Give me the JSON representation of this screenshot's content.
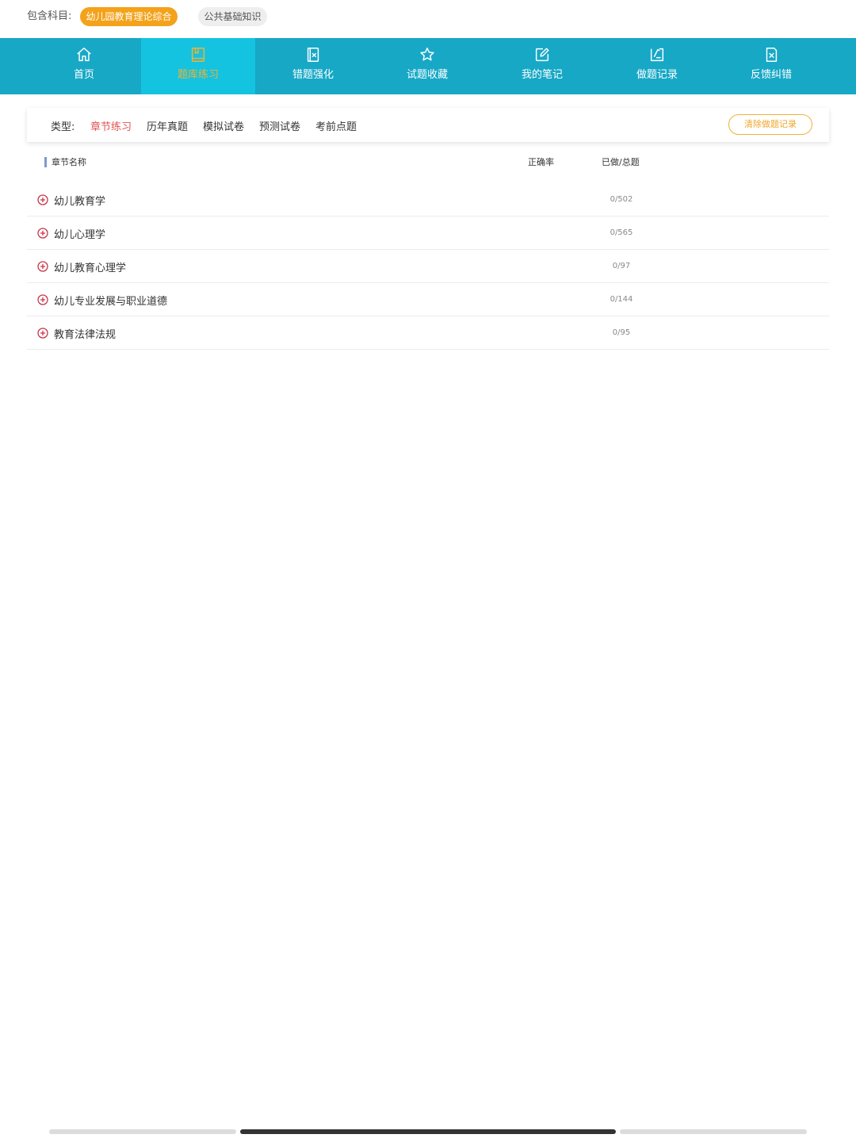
{
  "subject_bar": {
    "label": "包含科目:",
    "subjects": [
      {
        "label": "幼儿园教育理论综合",
        "active": true
      },
      {
        "label": "公共基础知识",
        "active": false
      }
    ]
  },
  "nav": {
    "items": [
      {
        "label": "首页",
        "icon": "home-icon"
      },
      {
        "label": "题库练习",
        "icon": "book-icon",
        "active": true
      },
      {
        "label": "错题强化",
        "icon": "error-doc-icon"
      },
      {
        "label": "试题收藏",
        "icon": "star-icon"
      },
      {
        "label": "我的笔记",
        "icon": "edit-note-icon"
      },
      {
        "label": "做题记录",
        "icon": "record-icon"
      },
      {
        "label": "反馈纠错",
        "icon": "feedback-x-icon"
      }
    ]
  },
  "type_filter": {
    "label": "类型:",
    "options": [
      "章节练习",
      "历年真题",
      "模拟试卷",
      "预测试卷",
      "考前点题"
    ],
    "selected": "章节练习",
    "clear_button": "清除做题记录"
  },
  "table": {
    "headers": {
      "name": "章节名称",
      "accuracy": "正确率",
      "progress": "已做/总题"
    },
    "rows": [
      {
        "name": "幼儿教育学",
        "progress": "0/502"
      },
      {
        "name": "幼儿心理学",
        "progress": "0/565"
      },
      {
        "name": "幼儿教育心理学",
        "progress": "0/97"
      },
      {
        "name": "幼儿专业发展与职业道德",
        "progress": "0/144"
      },
      {
        "name": "教育法律法规",
        "progress": "0/95"
      }
    ]
  },
  "colors": {
    "nav_bg": "#17a8c6",
    "nav_active_bg": "#14c3e0",
    "accent_orange": "#f3a21a",
    "selected_red": "#e35454"
  }
}
